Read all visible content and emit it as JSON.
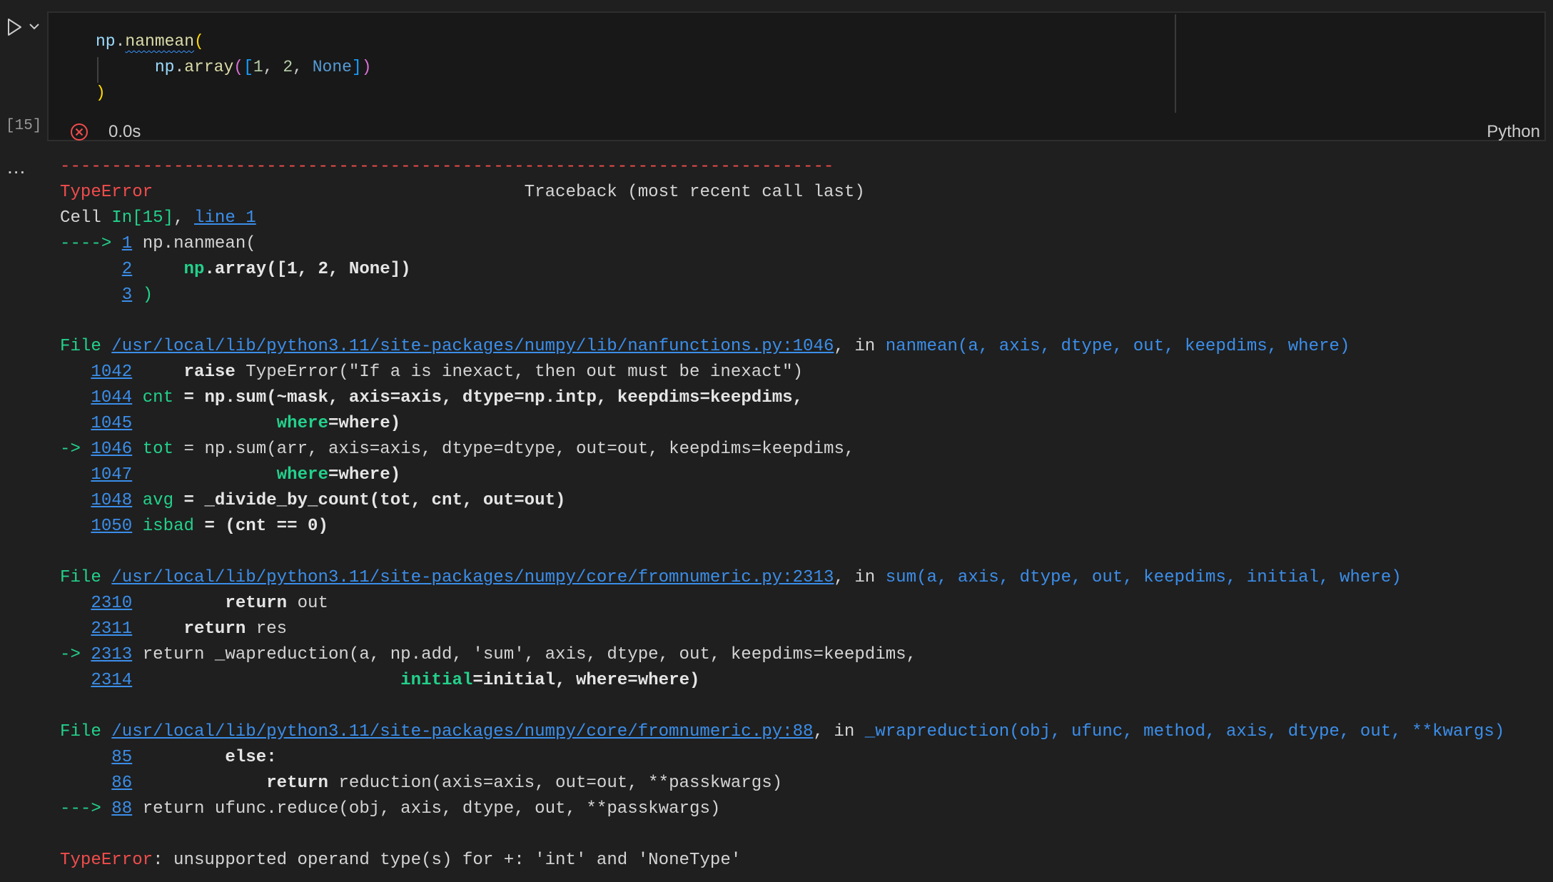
{
  "toolbar": {
    "run_icon": "play-icon",
    "run_options_icon": "chevron-down-icon"
  },
  "cell": {
    "execution_count": "[15]",
    "elapsed": "0.0s",
    "language": "Python",
    "status_icon": "error-circle-icon",
    "code": {
      "line1": {
        "obj": "np",
        "dot": ".",
        "fn": "nanmean",
        "paren": "("
      },
      "line2": {
        "obj": "np",
        "dot": ".",
        "fn": "array",
        "open": "(",
        "bracket_open": "[",
        "n1": "1",
        "sep1": ", ",
        "n2": "2",
        "sep2": ", ",
        "none": "None",
        "bracket_close": "]",
        "close": ")"
      },
      "line3": {
        "paren": ")"
      }
    }
  },
  "output": {
    "more_icon": "ellipsis-icon",
    "more_label": "...",
    "rule": "------------------------------------------------------------------------------------------------------------------------",
    "header": {
      "error_type": "TypeError",
      "gap": "                                    ",
      "title": "Traceback (most recent call last)"
    },
    "cell_ref": {
      "prefix": "Cell ",
      "in_label": "In[15]",
      "comma": ", ",
      "link": "line 1"
    },
    "cell_frame": [
      {
        "arrow": "----> ",
        "num": "1",
        "code": " np.nanmean("
      },
      {
        "arrow": "      ",
        "num": "2",
        "pre": "     ",
        "bold_g": "np",
        "code_b": ".array([1, 2, None])"
      },
      {
        "arrow": "      ",
        "num": "3",
        "code": " )"
      }
    ],
    "frame1": {
      "file_label": "File ",
      "path": "/usr/local/lib/python3.11/site-packages/numpy/lib/nanfunctions.py:1046",
      "in_text": ", in ",
      "func": "nanmean",
      "args": "(a, axis, dtype, out, keepdims, where)",
      "lines": [
        {
          "arrow": "   ",
          "num": "1042",
          "pre": "     ",
          "kw": "raise",
          "rest": " TypeError(\"If a is inexact, then out must be inexact\")"
        },
        {
          "arrow": "   ",
          "num": "1044",
          "pre": " ",
          "g": "cnt",
          "b": " = np.sum(~mask, axis=axis, dtype=np.intp, keepdims=keepdims,"
        },
        {
          "arrow": "   ",
          "num": "1045",
          "pre": "              ",
          "g": "where",
          "b": "=where)"
        },
        {
          "arrow": "-> ",
          "num": "1046",
          "pre": " ",
          "g": "tot",
          "rest": " = np.sum(arr, axis=axis, dtype=dtype, out=out, keepdims=keepdims,"
        },
        {
          "arrow": "   ",
          "num": "1047",
          "pre": "              ",
          "g": "where",
          "b": "=where)"
        },
        {
          "arrow": "   ",
          "num": "1048",
          "pre": " ",
          "g": "avg",
          "b": " = _divide_by_count(tot, cnt, out=out)"
        },
        {
          "arrow": "   ",
          "num": "1050",
          "pre": " ",
          "g": "isbad",
          "b": " = (cnt == 0)"
        }
      ]
    },
    "frame2": {
      "file_label": "File ",
      "path": "/usr/local/lib/python3.11/site-packages/numpy/core/fromnumeric.py:2313",
      "in_text": ", in ",
      "func": "sum",
      "args": "(a, axis, dtype, out, keepdims, initial, where)",
      "lines": [
        {
          "arrow": "   ",
          "num": "2310",
          "pre": "         ",
          "kw": "return",
          "rest": " out"
        },
        {
          "arrow": "   ",
          "num": "2311",
          "pre": "     ",
          "kw": "return",
          "rest": " res"
        },
        {
          "arrow": "-> ",
          "num": "2313",
          "pre": " ",
          "rest": "return _wapreduction(a, np.add, 'sum', axis, dtype, out, keepdims=keepdims,"
        },
        {
          "arrow": "   ",
          "num": "2314",
          "pre": "                          ",
          "g": "initial",
          "b": "=initial, where=where)"
        }
      ]
    },
    "frame3": {
      "file_label": "File ",
      "path": "/usr/local/lib/python3.11/site-packages/numpy/core/fromnumeric.py:88",
      "in_text": ", in ",
      "func": "_wrapreduction",
      "args": "(obj, ufunc, method, axis, dtype, out, **kwargs)",
      "lines": [
        {
          "arrow": "     ",
          "num": "85",
          "pre": "         ",
          "b": "else:"
        },
        {
          "arrow": "     ",
          "num": "86",
          "pre": "             ",
          "kw": "return",
          "rest": " reduction(axis=axis, out=out, **passkwargs)"
        },
        {
          "arrow": "---> ",
          "num": "88",
          "pre": " ",
          "rest": "return ufunc.reduce(obj, axis, dtype, out, **passkwargs)"
        }
      ]
    },
    "final": {
      "error_type": "TypeError",
      "message": ": unsupported operand type(s) for +: 'int' and 'NoneType'"
    }
  },
  "colors": {
    "background": "#1f1f1f",
    "cell_background": "#181818",
    "error_red": "#f14c4c",
    "ansi_green": "#23d18b",
    "ansi_blue": "#3b8eea"
  }
}
